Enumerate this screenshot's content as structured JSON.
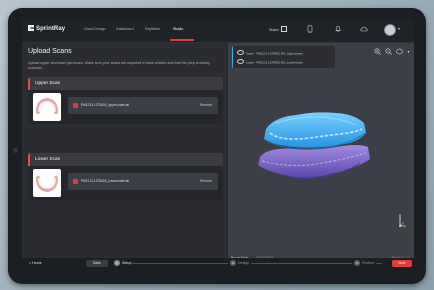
{
  "brand": {
    "name": "SprintRay"
  },
  "nav": {
    "items": [
      "Cloud Design",
      "Dashboard",
      "RayWare",
      "Studio"
    ],
    "active": "Studio",
    "share_label": "Share"
  },
  "page": {
    "title": "Upload Scans",
    "subtitle": "Upload upper and lower jaw scans. Make sure your scans are exported in false-relation and that the prep is clearly scanned."
  },
  "scans": [
    {
      "label": "Upper Scan",
      "file": "PM1213-1275403_Upper.lower.stl",
      "remove_label": "Remove"
    },
    {
      "label": "Lower Scan",
      "file": "PM1213-1275403_Lower.lower.stl",
      "remove_label": "Remove"
    }
  ],
  "footer": {
    "links": "Privacy Policy  ·  Terms & Conditions  ·  Give Feedback"
  },
  "viewer": {
    "layers": [
      {
        "label": "Upper  ·  PM1213-1275403_NG_Upper.lower..."
      },
      {
        "label": "Lower  ·  PM1213-1275403_NG_Lower.lower..."
      }
    ],
    "patient_name": "Bruce Mark",
    "date": "10.20.2022",
    "version": "Studio v1.0.1"
  },
  "bottom": {
    "home_label": "Home",
    "back_label": "Back",
    "steps": [
      {
        "num": "1",
        "label": "Setup"
      },
      {
        "num": "2",
        "label": "Design"
      },
      {
        "num": "3",
        "label": "Review"
      }
    ],
    "active_step": "Setup",
    "next_label": "Next"
  },
  "colors": {
    "accent": "#e23b3b",
    "upper_model": "#36a9ef",
    "lower_model": "#7f68c8",
    "panel": "#2a2c31",
    "viewer_bg": "#3c3f45"
  },
  "icons": {
    "share": "share-icon",
    "phone": "phone-icon",
    "bell": "bell-icon",
    "cloud": "cloud-icon",
    "zoom_in": "zoom-in-icon",
    "zoom_out": "zoom-out-icon",
    "view": "view-cube-icon",
    "home": "home-icon"
  }
}
